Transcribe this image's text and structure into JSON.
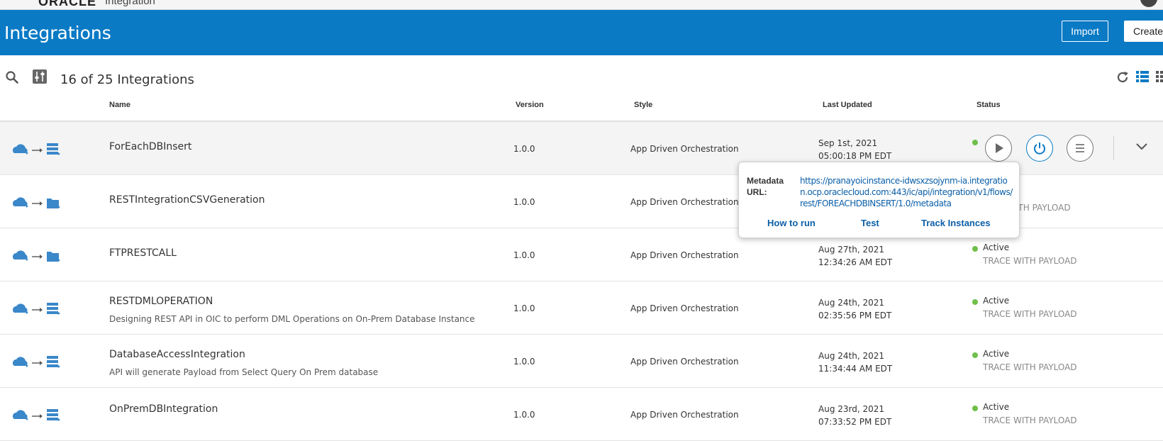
{
  "topbar": {
    "brand": "ORACLE",
    "product": "Integration"
  },
  "header": {
    "title": "Integrations",
    "import_label": "Import",
    "create_label": "Create"
  },
  "toolbar": {
    "count_text": "16 of 25 Integrations"
  },
  "columns": {
    "name": "Name",
    "version": "Version",
    "style": "Style",
    "last_updated": "Last Updated",
    "status": "Status"
  },
  "rows": [
    {
      "name": "ForEachDBInsert",
      "description": "",
      "version": "1.0.0",
      "style": "App Driven Orchestration",
      "date": "Sep 1st, 2021",
      "time": "05:00:18 PM EDT",
      "status": "",
      "trace": ""
    },
    {
      "name": "RESTIntegrationCSVGeneration",
      "description": "",
      "version": "1.0.0",
      "style": "App Driven Orchestration",
      "date": "",
      "time": "",
      "status": "",
      "trace": "WITH PAYLOAD"
    },
    {
      "name": "FTPRESTCALL",
      "description": "",
      "version": "1.0.0",
      "style": "App Driven Orchestration",
      "date": "Aug 27th, 2021",
      "time": "12:34:26 AM EDT",
      "status": "Active",
      "trace": "TRACE WITH PAYLOAD"
    },
    {
      "name": "RESTDMLOPERATION",
      "description": "Designing REST API in OIC to perform DML Operations on On-Prem Database Instance",
      "version": "1.0.0",
      "style": "App Driven Orchestration",
      "date": "Aug 24th, 2021",
      "time": "02:35:56 PM EDT",
      "status": "Active",
      "trace": "TRACE WITH PAYLOAD"
    },
    {
      "name": "DatabaseAccessIntegration",
      "description": "API will generate Payload from Select Query On Prem database",
      "version": "1.0.0",
      "style": "App Driven Orchestration",
      "date": "Aug 24th, 2021",
      "time": "11:34:44 AM EDT",
      "status": "Active",
      "trace": "TRACE WITH PAYLOAD"
    },
    {
      "name": "OnPremDBIntegration",
      "description": "",
      "version": "1.0.0",
      "style": "App Driven Orchestration",
      "date": "Aug 23rd, 2021",
      "time": "07:33:52 PM EDT",
      "status": "Active",
      "trace": "TRACE WITH PAYLOAD"
    }
  ],
  "popup": {
    "label": "Metadata URL:",
    "url": "https://pranayoicinstance-idwsxzsojynm-ia.integration.ocp.oraclecloud.com:443/ic/api/integration/v1/flows/rest/FOREACHDBINSERT/1.0/metadata",
    "how_to_run": "How to run",
    "test": "Test",
    "track_instances": "Track Instances"
  },
  "colors": {
    "banner": "#0a7ac5",
    "active_dot": "#6fbf4a",
    "link": "#0b5fa8"
  }
}
